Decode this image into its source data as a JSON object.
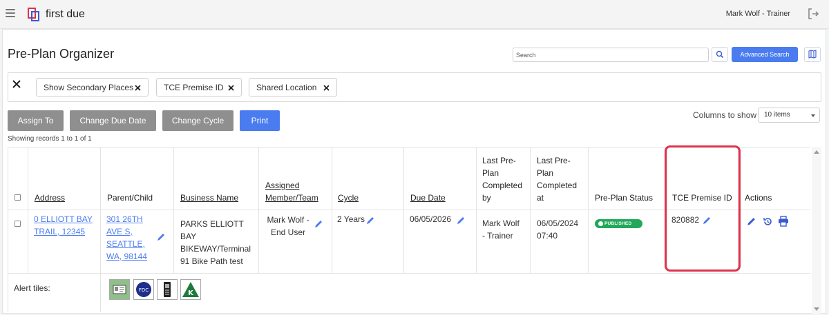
{
  "app": {
    "brand": "first due",
    "user": "Mark Wolf - Trainer"
  },
  "page": {
    "title": "Pre-Plan Organizer"
  },
  "search": {
    "placeholder": "Search",
    "advanced_label": "Advanced Search"
  },
  "filters": [
    "Show Secondary Places",
    "TCE Premise ID",
    "Shared Location"
  ],
  "actions": {
    "assign": "Assign To",
    "due": "Change Due Date",
    "cycle": "Change Cycle",
    "print": "Print"
  },
  "columns_to_show": {
    "label": "Columns to show",
    "value": "10 items"
  },
  "showing": "Showing records 1 to 1 of 1",
  "table": {
    "headers": {
      "address": "Address",
      "parent": "Parent/Child",
      "business": "Business Name",
      "assigned": [
        "Assigned",
        "Member/Team"
      ],
      "cycle": "Cycle",
      "due": "Due Date",
      "last_by": [
        "Last Pre-",
        "Plan",
        "Completed",
        "by"
      ],
      "last_at": [
        "Last Pre-",
        "Plan",
        "Completed",
        "at"
      ],
      "status": "Pre-Plan Status",
      "tce": "TCE Premise ID",
      "actions": "Actions"
    },
    "row": {
      "address": [
        "0 ELLIOTT BAY",
        "TRAIL, 12345"
      ],
      "parent": [
        "301 26TH",
        "AVE S,",
        "SEATTLE,",
        "WA, 98144"
      ],
      "business": [
        "PARKS ELLIOTT",
        "BAY",
        "BIKEWAY/Terminal",
        "91 Bike Path test"
      ],
      "assigned": [
        "Mark Wolf -",
        "End User"
      ],
      "cycle": "2 Years",
      "due": "06/05/2026",
      "last_by": [
        "Mark Wolf",
        "- Trainer"
      ],
      "last_at": [
        "06/05/2024",
        "07:40"
      ],
      "status": "PUBLISHED",
      "tce": "820882"
    }
  },
  "alert_tiles": {
    "label": "Alert tiles:",
    "tiles": [
      "id-card-icon",
      "fdc-icon",
      "phone-icon",
      "knox-box-icon"
    ],
    "fdc_text": "FDC",
    "knox_text": "K"
  },
  "colors": {
    "primary": "#4a7cf0",
    "published": "#22a85a",
    "highlight": "#e0314b",
    "gray_button": "#8f8f8f"
  }
}
